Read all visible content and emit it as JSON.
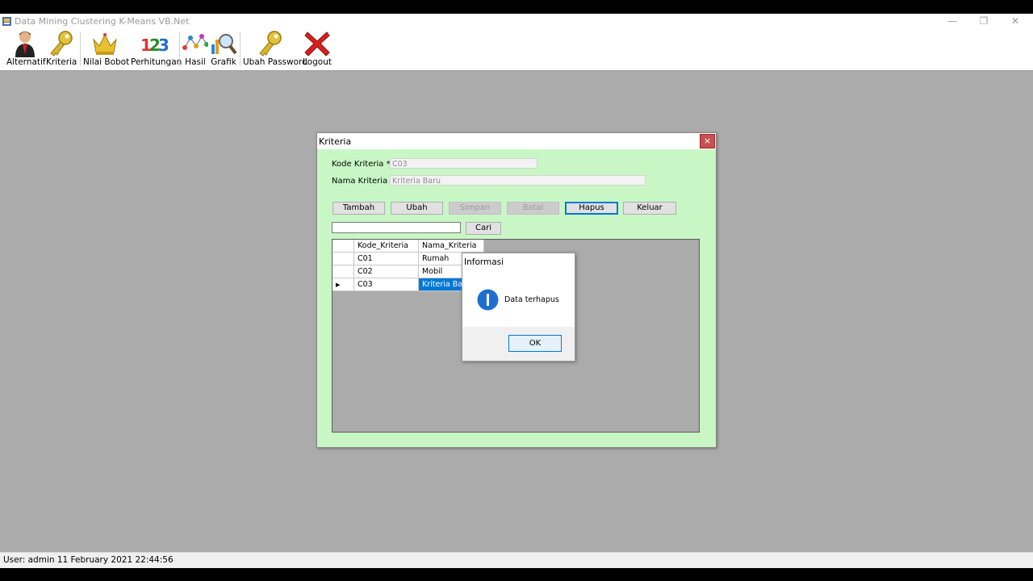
{
  "window": {
    "title": "Data Mining Clustering K-Means VB.Net",
    "minimize": "—",
    "restore": "❐",
    "close": "✕"
  },
  "toolbar": {
    "items": [
      {
        "label": "Alternatif",
        "icon": "user-icon"
      },
      {
        "label": "Kriteria",
        "icon": "key-icon"
      },
      {
        "label": "Nilai Bobot",
        "icon": "crown-icon"
      },
      {
        "label": "Perhitungan",
        "icon": "numbers-123-icon"
      },
      {
        "label": "Hasil",
        "icon": "scatter-chart-icon"
      },
      {
        "label": "Grafik",
        "icon": "magnifier-chart-icon"
      },
      {
        "label": "Ubah Password",
        "icon": "key-icon"
      },
      {
        "label": "Logout",
        "icon": "close-x-icon"
      }
    ]
  },
  "statusbar": {
    "text": "User: admin  11 February 2021 22:44:56"
  },
  "kriteria": {
    "title": "Kriteria",
    "close": "×",
    "kode_label": "Kode Kriteria *",
    "kode_value": "C03",
    "nama_label": "Nama Kriteria *",
    "nama_value": "Kriteria Baru",
    "buttons": {
      "tambah": "Tambah",
      "ubah": "Ubah",
      "simpan": "Simpan",
      "batal": "Batal",
      "hapus": "Hapus",
      "keluar": "Keluar",
      "cari": "Cari"
    },
    "search_value": "",
    "grid": {
      "columns": [
        "Kode_Kriteria",
        "Nama_Kriteria"
      ],
      "rows": [
        [
          "C01",
          "Rumah"
        ],
        [
          "C02",
          "Mobil"
        ],
        [
          "C03",
          "Kriteria Baru"
        ]
      ],
      "current_row_marker": "▶"
    }
  },
  "message": {
    "title": "Informasi",
    "icon": "info-icon",
    "text": "Data terhapus",
    "ok": "OK"
  },
  "colors": {
    "form_bg": "#c8f7c5",
    "mdi_bg": "#ababab",
    "selection": "#0078d7",
    "close_red": "#c75050"
  }
}
